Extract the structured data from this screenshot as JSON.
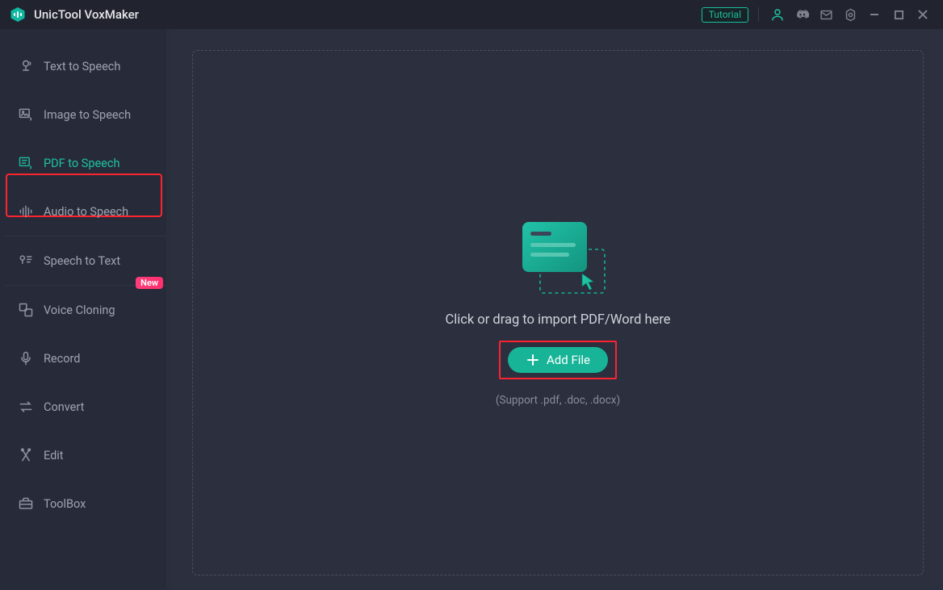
{
  "app": {
    "title": "UnicTool VoxMaker"
  },
  "titlebar": {
    "tutorial": "Tutorial"
  },
  "sidebar": {
    "items": [
      {
        "label": "Text to Speech"
      },
      {
        "label": "Image to Speech"
      },
      {
        "label": "PDF to Speech"
      },
      {
        "label": "Audio to Speech"
      },
      {
        "label": "Speech to Text"
      },
      {
        "label": "Voice Cloning",
        "badge": "New"
      },
      {
        "label": "Record"
      },
      {
        "label": "Convert"
      },
      {
        "label": "Edit"
      },
      {
        "label": "ToolBox"
      }
    ]
  },
  "main": {
    "drop_message": "Click or drag to import PDF/Word here",
    "add_file_label": "Add File",
    "support_text": "(Support .pdf, .doc, .docx)"
  }
}
